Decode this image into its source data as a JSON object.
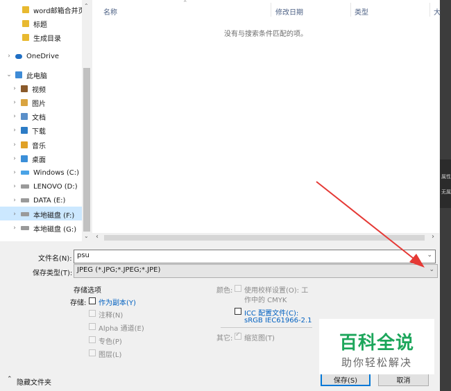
{
  "nav": {
    "items": [
      {
        "label": "word邮箱合并页",
        "icon": "folder-icon"
      },
      {
        "label": "标题",
        "icon": "folder-icon"
      },
      {
        "label": "生成目录",
        "icon": "folder-icon"
      },
      {
        "label": "OneDrive",
        "icon": "onedrive-icon"
      },
      {
        "label": "此电脑",
        "icon": "computer-icon"
      },
      {
        "label": "视频",
        "icon": "video-folder-icon"
      },
      {
        "label": "图片",
        "icon": "pictures-folder-icon"
      },
      {
        "label": "文档",
        "icon": "documents-folder-icon"
      },
      {
        "label": "下载",
        "icon": "downloads-folder-icon"
      },
      {
        "label": "音乐",
        "icon": "music-folder-icon"
      },
      {
        "label": "桌面",
        "icon": "desktop-folder-icon"
      },
      {
        "label": "Windows (C:)",
        "icon": "windows-drive-icon"
      },
      {
        "label": "LENOVO (D:)",
        "icon": "drive-icon"
      },
      {
        "label": "DATA (E:)",
        "icon": "drive-icon"
      },
      {
        "label": "本地磁盘 (F:)",
        "icon": "drive-icon"
      },
      {
        "label": "本地磁盘 (G:)",
        "icon": "drive-icon"
      }
    ]
  },
  "list": {
    "columns": [
      "名称",
      "修改日期",
      "类型",
      "大"
    ],
    "empty_message": "没有与搜索条件匹配的项。"
  },
  "form": {
    "filename_label": "文件名(N):",
    "filename_value": "psu",
    "filetype_label": "保存类型(T):",
    "filetype_value": "JPEG (*.JPG;*.JPEG;*.JPE)"
  },
  "options": {
    "heading": "存储选项",
    "storage_label": "存储:",
    "as_copy": "作为副本(Y)",
    "notes": "注释(N)",
    "alpha": "Alpha 通道(E)",
    "spot": "专色(P)",
    "layers": "图层(L)",
    "color_label": "颜色:",
    "proof_line1": "使用校样设置(O): 工",
    "proof_line2": "作中的 CMYK",
    "icc_line1": "ICC 配置文件(C):",
    "icc_line2": "sRGB IEC61966-2.1",
    "other_label": "其它:",
    "thumbnail": "缩览图(T)"
  },
  "footer": {
    "hide_folders": "隐藏文件夹",
    "save": "保存(S)",
    "cancel": "取消"
  },
  "right_strip": {
    "text1": "属性",
    "text2": "无属"
  },
  "watermark": {
    "title": "百科全说",
    "subtitle": "助你轻松解决"
  },
  "colors": {
    "arrow": "#e53935",
    "watermark_green": "#1ca65b",
    "selection": "#cce8ff",
    "link": "#0060c0"
  }
}
